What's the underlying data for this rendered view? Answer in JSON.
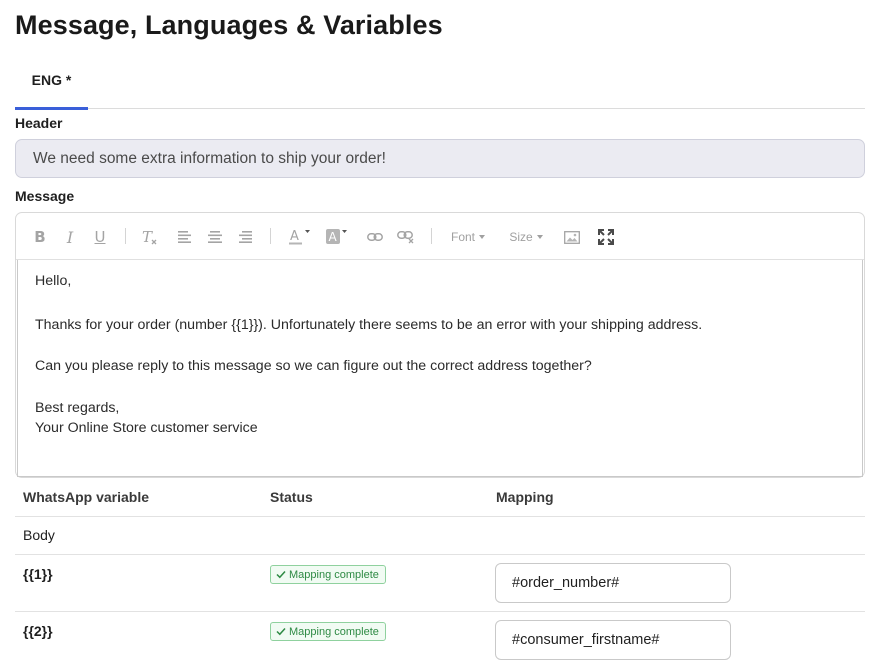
{
  "page": {
    "title": "Message, Languages & Variables"
  },
  "tabs": [
    {
      "label": "ENG *",
      "active": true
    }
  ],
  "header_section": {
    "label": "Header",
    "value": "We need some extra information to ship your order!"
  },
  "message_section": {
    "label": "Message",
    "toolbar": {
      "font_label": "Font",
      "size_label": "Size",
      "items": [
        "bold-icon",
        "italic-icon",
        "underline-icon",
        "clear-format-icon",
        "align-left-icon",
        "align-center-icon",
        "align-right-icon",
        "text-color-icon",
        "highlight-color-icon",
        "link-icon",
        "unlink-icon",
        "font-dropdown",
        "size-dropdown",
        "image-icon",
        "fullscreen-icon"
      ]
    },
    "body": {
      "line1": "Hello,",
      "line2": "Thanks for your order (number {{1}}). Unfortunately there seems to be an error with your shipping address.",
      "line3": "Can you please reply to this message so we can figure out the correct address together?",
      "line4": "Best regards,",
      "line5": "Your Online Store customer service"
    }
  },
  "variables_table": {
    "headers": {
      "variable": "WhatsApp variable",
      "status": "Status",
      "mapping": "Mapping"
    },
    "group_label": "Body",
    "rows": [
      {
        "variable": "{{1}}",
        "status": "Mapping complete",
        "mapping": "#order_number#"
      },
      {
        "variable": "{{2}}",
        "status": "Mapping complete",
        "mapping": "#consumer_firstname#"
      }
    ]
  },
  "colors": {
    "accent": "#3a5fd9",
    "success": "#2e8a44",
    "success_bg": "#f1fbf3",
    "header_input_bg": "#ebebf2"
  }
}
